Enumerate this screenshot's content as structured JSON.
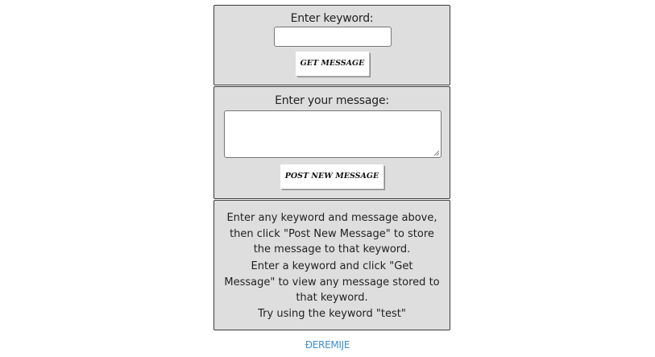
{
  "get_section": {
    "label": "Enter keyword:",
    "keyword_value": "",
    "button_label": "GET MESSAGE"
  },
  "post_section": {
    "label": "Enter your message:",
    "message_value": "",
    "button_label": "POST NEW MESSAGE"
  },
  "info": {
    "paragraph_1": [
      "Enter any keyword and message above,",
      "then click \"Post New Message\" to store",
      "the message to that keyword."
    ],
    "paragraph_2": [
      "Enter a keyword and click \"Get",
      "Message\" to view any message stored to",
      "that keyword."
    ],
    "paragraph_3": "Try using the keyword \"test\""
  },
  "footer": {
    "link_text": "ĐEREMIJE",
    "link_color": "#3e8ed0"
  },
  "colors": {
    "panel_background": "#dedede",
    "panel_border": "#3c3c3c"
  }
}
